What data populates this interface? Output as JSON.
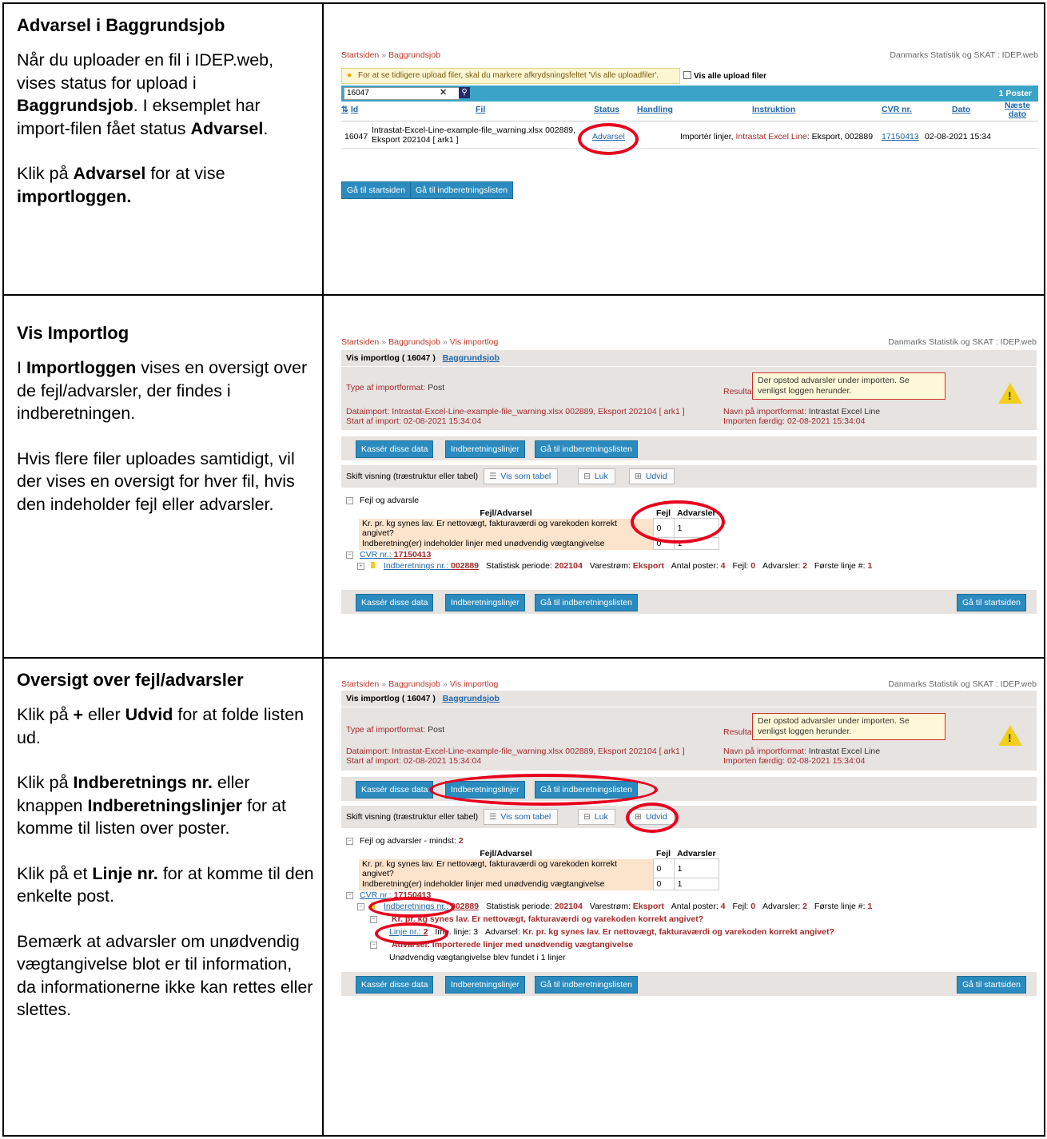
{
  "sections": [
    {
      "heading": "Advarsel i Baggrundsjob",
      "paragraphs": [
        [
          "Når du uploader en fil i IDEP.web, vises status for upload i ",
          "Baggrundsjob",
          ". I eksemplet har import-filen fået status ",
          "Advarsel",
          "."
        ],
        [
          "Klik på ",
          "Advarsel",
          " for at vise ",
          "importloggen."
        ]
      ]
    },
    {
      "heading": "Vis Importlog",
      "paragraphs": [
        [
          "I ",
          "Importloggen",
          " vises en oversigt over de fejl/advarsler, der findes i indberetningen."
        ],
        [
          "Hvis flere filer uploades samtidigt, vil der vises en oversigt for hver fil, hvis den indeholder fejl eller advarsler."
        ]
      ]
    },
    {
      "heading": "Oversigt over fejl/advarsler",
      "paragraphs": [
        [
          "Klik på ",
          "+",
          " eller ",
          "Udvid",
          " for at folde listen ud."
        ],
        [
          "Klik på ",
          "Indberetnings nr.",
          " eller knappen ",
          "Indberetningslinjer",
          " for at komme til listen over poster."
        ],
        [
          "Klik på et ",
          "Linje nr.",
          " for at komme til den enkelte post."
        ],
        [
          "Bemærk at advarsler om unødvendig vægtangivelse blot er til information, da informationerne ikke kan rettes eller slettes."
        ]
      ]
    }
  ],
  "shot1": {
    "crumb_home": "Startsiden",
    "crumb_sep": "»",
    "crumb_jobs": "Baggrundsjob",
    "brand": "Danmarks Statistik og SKAT : IDEP.web",
    "hint": "For at se tidligere upload filer, skal du markere afkrydsningsfeltet 'Vis alle uploadfiler'.",
    "show_all": "Vis alle upload filer",
    "search_value": "16047",
    "count": "1 Poster",
    "headers": {
      "id": "Id",
      "fil": "Fil",
      "status": "Status",
      "handling": "Handling",
      "instruktion": "Instruktion",
      "cvr": "CVR nr.",
      "dato": "Dato",
      "naeste": "Næste dato"
    },
    "row": {
      "id": "16047",
      "fil1": "Intrastat-Excel-Line-example-file_warning.xlsx 002889,",
      "fil2": "Eksport 202104 [ ark1 ]",
      "status": "Advarsel",
      "instr_a": "Importér linjer, ",
      "instr_b": "Intrastat Excel Line",
      "instr_c": ": Eksport, 002889",
      "cvr": "17150413",
      "dato": "02-08-2021 15:34"
    },
    "btn_start": "Gå til startsiden",
    "btn_list": "Gå til indberetningslisten"
  },
  "log": {
    "crumb_home": "Startsiden",
    "crumb_sep": "»",
    "crumb_jobs": "Baggrundsjob",
    "crumb_log": "Vis importlog",
    "brand": "Danmarks Statistik og SKAT : IDEP.web",
    "title": "Vis importlog ( 16047 )",
    "title_link": "Baggrundsjob",
    "type_label": "Type af importformat: ",
    "type_value": "Post",
    "result_label": "Resultat:",
    "result_text": "Der opstod advarsler under importen. Se venligst loggen herunder.",
    "dataimport_label": "Dataimport: ",
    "dataimport_value": "Intrastat-Excel-Line-example-file_warning.xlsx 002889, Eksport 202104 [ ark1 ]",
    "start_label": "Start af import: ",
    "start_value": "02-08-2021 15:34:04",
    "name_label": "Navn på importformat: ",
    "name_value": "Intrastat Excel Line",
    "done_label": "Importen færdig: ",
    "done_value": "02-08-2021 15:34:04",
    "btn_discard": "Kassér disse data",
    "btn_lines": "Indberetningslinjer",
    "btn_list": "Gå til indberetningslisten",
    "btn_start": "Gå til startsiden",
    "switch_label": "Skift visning (træstruktur eller tabel)",
    "vis_tabel": "Vis som tabel",
    "luk": "Luk",
    "udvid": "Udvid",
    "fejl_head": "Fejl og advarsle",
    "fejl_head_full": "Fejl og advarsler - mindst: ",
    "fejl_min": "2",
    "col_fa": "Fejl/Advarsel",
    "col_fejl": "Fejl",
    "col_adv": "Advarsler",
    "w1": "Kr. pr. kg synes lav. Er nettovægt, fakturaværdi og varekoden korrekt angivet?",
    "w2": "Indberetning(er) indeholder linjer med unødvendig vægtangivelse",
    "w_fejl": "0",
    "w_adv": "1",
    "cvr_label": "CVR nr.: ",
    "cvr_value": "17150413",
    "ind_label": "Indberetnings nr.: ",
    "ind_value": "002889",
    "per_label": "Statistisk periode: ",
    "per_value": "202104",
    "var_label": "Varestrøm: ",
    "var_value": "Eksport",
    "ap_label": "Antal poster: ",
    "ap_value": "4",
    "fejl_label": "Fejl: ",
    "fejl_value": "0",
    "adv_label": "Advarsler: ",
    "adv_value": "2",
    "first_label": "Første linje #: ",
    "first_value": "1",
    "exp_w1": "Kr. pr. kg synes lav. Er nettovægt, fakturaværdi og varekoden korrekt angivet?",
    "linje_label": "Linje nr.: ",
    "linje_value": "2",
    "imp_label": "Imp. linje: ",
    "imp_value": "3",
    "advarsel_label": "Advarsel: ",
    "exp_w2_head": "Advarsel: Importerede linjer med unødvendig vægtangivelse",
    "exp_w2_detail": "Unødvendig vægtangivelse blev fundet i 1 linjer"
  },
  "colors": {
    "link": "#2266aa",
    "button": "#2b8bbf",
    "highlight": "#e8001c",
    "warning": "#f2cf1d"
  }
}
